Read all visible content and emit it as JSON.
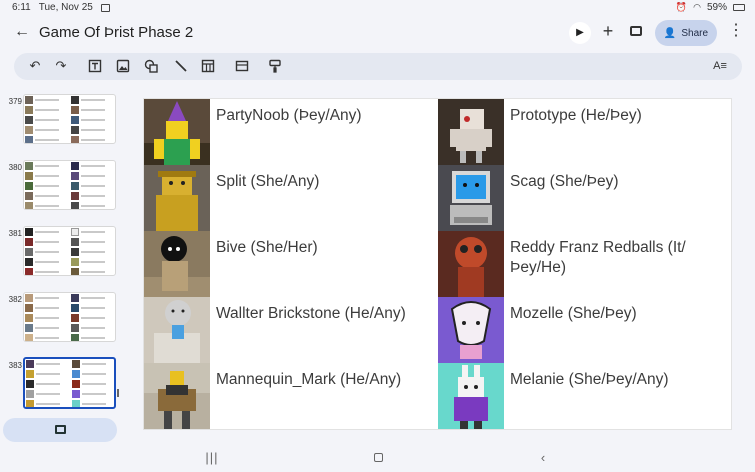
{
  "status_bar": {
    "time": "6:11",
    "date": "Tue, Nov 25",
    "battery": "59%"
  },
  "app_bar": {
    "title": "Game Of Þrist Phase 2",
    "share_label": "Share"
  },
  "toolbar": {
    "tools": [
      "undo-icon",
      "redo-icon",
      "text-box-icon",
      "image-icon",
      "shape-icon",
      "line-icon",
      "table-icon",
      "layout-icon",
      "paint-format-icon"
    ],
    "format_options": "format-options-icon"
  },
  "filmstrip": {
    "slides": [
      {
        "number": "379",
        "selected": false
      },
      {
        "number": "380",
        "selected": false
      },
      {
        "number": "381",
        "selected": false
      },
      {
        "number": "382",
        "selected": false
      },
      {
        "number": "383",
        "selected": true
      }
    ],
    "new_slide": "add-slide-icon"
  },
  "slide": {
    "left_column": [
      {
        "label": "PartyNoob (Þey/Any)"
      },
      {
        "label": "Split (She/Any)"
      },
      {
        "label": "Bive (She/Her)"
      },
      {
        "label": "Wallter Brickstone (He/Any)"
      },
      {
        "label": "Mannequin_Mark (He/Any)"
      }
    ],
    "right_column": [
      {
        "label": "Prototype (He/Þey)"
      },
      {
        "label": "Scag (She/Þey)"
      },
      {
        "label": "Reddy Franz Redballs (It/ Þey/He)"
      },
      {
        "label": "Mozelle (She/Þey)"
      },
      {
        "label": "Melanie (She/Þey/Any)"
      }
    ]
  },
  "colors": {
    "accent": "#1a4fbd",
    "share_bg": "#c7d3ec",
    "toolbar_bg": "#e4e8f1",
    "app_bg": "#f3f4f9"
  }
}
